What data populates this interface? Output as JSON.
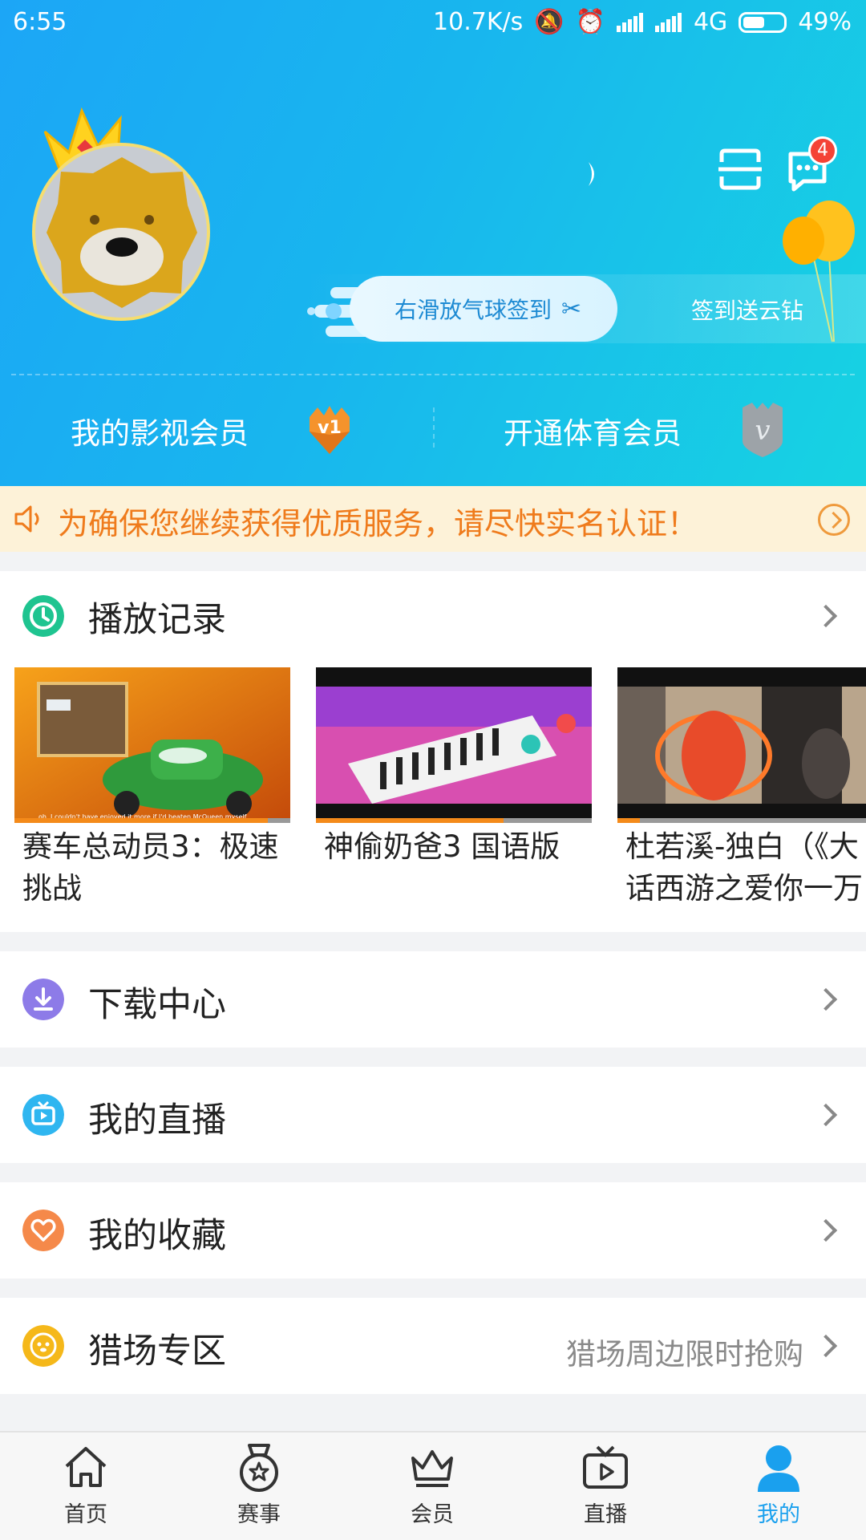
{
  "status_bar": {
    "time": "6:55",
    "net_speed": "10.7K/s",
    "network": "4G",
    "battery": "49%"
  },
  "header": {
    "message_badge": "4",
    "checkin_label": "右滑放气球签到",
    "checkin_reward": "签到送云钻",
    "vip_video_label": "我的影视会员",
    "vip_video_level": "v1",
    "vip_sports_label": "开通体育会员",
    "vip_sports_level": "v",
    "colors": {
      "gradient_start": "#1ca6f6",
      "gradient_end": "#17d3e2"
    }
  },
  "notice": {
    "text": "为确保您继续获得优质服务，请尽快实名认证！",
    "color": "#ef7b1c"
  },
  "history": {
    "title": "播放记录",
    "icon": "clock-icon",
    "items": [
      {
        "title": "赛车总动员3：极速挑战",
        "thumb_subtitle": "oh, I couldn't have enjoyed it more if I'd beaten McQueen myself",
        "progress": 0.92
      },
      {
        "title": "神偷奶爸3 国语版",
        "progress": 0.68
      },
      {
        "title": "杜若溪-独白（《大话西游之爱你一万年》",
        "progress": 0.08
      }
    ]
  },
  "menu": [
    {
      "label": "下载中心",
      "icon": "download-icon",
      "color": "#8d7be8",
      "hint": ""
    },
    {
      "label": "我的直播",
      "icon": "tv-icon",
      "color": "#2fb6f0",
      "hint": ""
    },
    {
      "label": "我的收藏",
      "icon": "heart-icon",
      "color": "#f5894a",
      "hint": ""
    },
    {
      "label": "猎场专区",
      "icon": "lion-icon",
      "color": "#f5b81a",
      "hint": "猎场周边限时抢购"
    }
  ],
  "bottom_nav": [
    {
      "label": "首页",
      "icon": "home-icon",
      "active": false
    },
    {
      "label": "赛事",
      "icon": "medal-icon",
      "active": false
    },
    {
      "label": "会员",
      "icon": "crown-icon",
      "active": false
    },
    {
      "label": "直播",
      "icon": "live-tv-icon",
      "active": false
    },
    {
      "label": "我的",
      "icon": "user-icon",
      "active": true
    }
  ],
  "accent_color": "#1aa0ee"
}
